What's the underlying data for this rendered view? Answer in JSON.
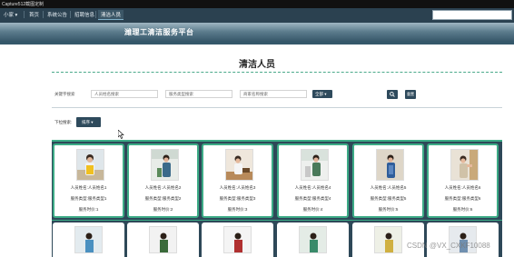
{
  "window": {
    "title": "Capture512截图定制"
  },
  "nav": {
    "items": [
      {
        "label": "小家 ▾",
        "selected": false
      },
      {
        "label": "首页",
        "selected": false
      },
      {
        "label": "系统公告",
        "selected": false
      },
      {
        "label": "招聘信息",
        "selected": false
      },
      {
        "label": "清洁人员",
        "selected": true
      }
    ]
  },
  "banner": {
    "title": "潍理工清洁服务平台"
  },
  "page": {
    "title": "清洁人员"
  },
  "search": {
    "label": "关键字搜索",
    "name_placeholder": "人员姓名搜索",
    "type_placeholder": "服务类型搜索",
    "price_placeholder": "商家名称搜索",
    "select_value": "全部 ▾",
    "reset_label": "重置"
  },
  "sort": {
    "label": "下拉搜索:",
    "button_label": "排序 ▾"
  },
  "cards": [
    {
      "name": "人员姓名:人员姓名1",
      "type": "服务类型:服务类型1",
      "price": "服务时价:1"
    },
    {
      "name": "人员姓名:人员姓名2",
      "type": "服务类型:服务类型2",
      "price": "服务时价:2"
    },
    {
      "name": "人员姓名:人员姓名3",
      "type": "服务类型:服务类型3",
      "price": "服务时价:3"
    },
    {
      "name": "人员姓名:人员姓名4",
      "type": "服务类型:服务类型4",
      "price": "服务时价:4"
    },
    {
      "name": "人员姓名:人员姓名5",
      "type": "服务类型:服务类型5",
      "price": "服务时价:5"
    },
    {
      "name": "人员姓名:人员姓名6",
      "type": "服务类型:服务类型6",
      "price": "服务时价:6"
    }
  ],
  "watermark": "CSDN @VX_CXKF10088",
  "colors": {
    "nav_bg": "#2b4150",
    "accent": "#3cab86",
    "button": "#2e4a5c"
  }
}
